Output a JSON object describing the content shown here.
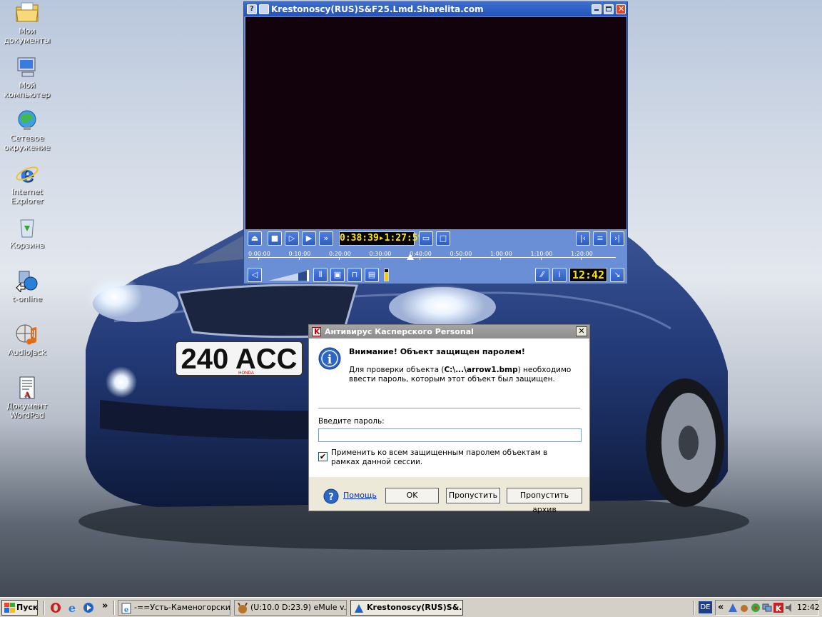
{
  "desktop": {
    "icons": [
      {
        "label": "Мои документы",
        "icon": "folder-documents-icon"
      },
      {
        "label": "Мой компьютер",
        "icon": "my-computer-icon"
      },
      {
        "label": "Сетевое окружение",
        "icon": "network-icon"
      },
      {
        "label": "Internet Explorer",
        "icon": "internet-explorer-icon"
      },
      {
        "label": "Корзина",
        "icon": "recycle-bin-icon"
      },
      {
        "label": "t-online",
        "icon": "t-online-icon"
      },
      {
        "label": "AudioJack",
        "icon": "audiojack-icon"
      },
      {
        "label": "Документ WordPad",
        "icon": "wordpad-document-icon"
      }
    ],
    "wallpaper": {
      "plate": "240 ACC",
      "plate_brand": "HONDA"
    }
  },
  "player": {
    "title": "Krestonoscy(RUS)S&F25.Lmd.Sharelita.com",
    "time_display": "0:38:39▸1:27:59",
    "clock": "12:42",
    "timeline_ticks": [
      "0:00:00",
      "0:10:00",
      "0:20:00",
      "0:30:00",
      "0:40:00",
      "0:50:00",
      "1:00:00",
      "1:10:00",
      "1:20:00"
    ],
    "progress": 0.44,
    "volume": 0.75
  },
  "dialog": {
    "title": "Антивирус Касперского Personal",
    "heading": "Внимание! Объект защищен паролем!",
    "message_before": "Для проверки объекта (",
    "message_file": "C:\\...\\arrow1.bmp",
    "message_after": ") необходимо ввести пароль, которым этот объект был защищен.",
    "password_label": "Введите пароль:",
    "password_value": "",
    "checkbox_label": "Применить ко всем защищенным паролем объектам в рамках данной сессии.",
    "checkbox_checked": true,
    "help_label": "Помощь",
    "ok_label": "OK",
    "skip_label": "Пропустить",
    "skip_archive_label": "Пропустить архив"
  },
  "taskbar": {
    "start_label": "Пуск",
    "quick_more": "»",
    "tasks": [
      {
        "label": "-==Усть-Каменогорски...",
        "active": false
      },
      {
        "label": "(U:10.0 D:23.9) eMule v...",
        "active": false
      },
      {
        "label": "Krestonoscy(RUS)S&...",
        "active": true
      }
    ],
    "language": "DE",
    "tray_more": "«",
    "clock": "12:42"
  }
}
